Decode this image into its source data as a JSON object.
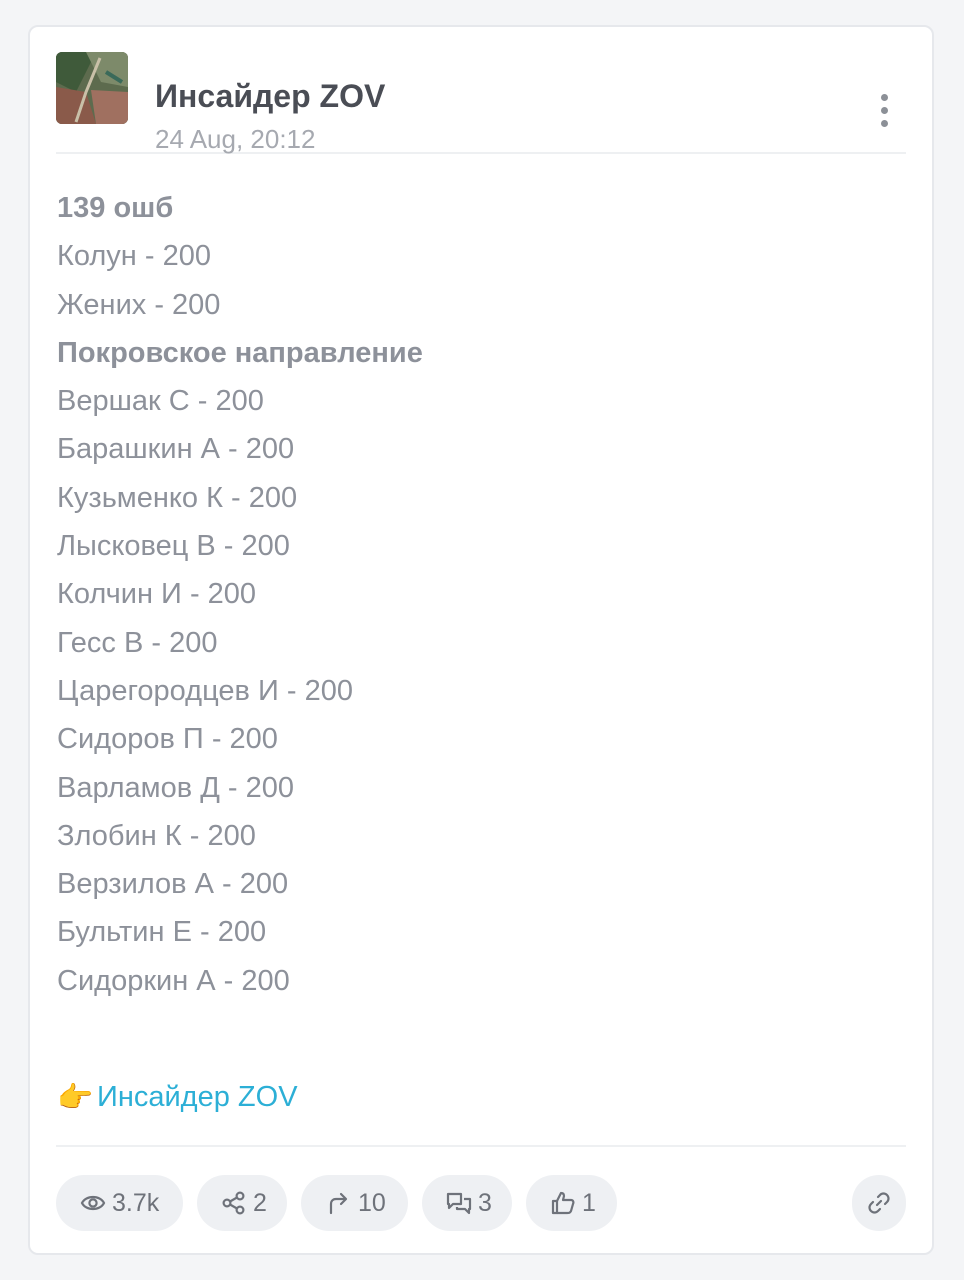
{
  "post": {
    "channel_name": "Инсайдер ZOV",
    "time": "24 Aug, 20:12",
    "lines": [
      {
        "text": "139 ошб",
        "bold": true
      },
      {
        "text": "Колун - 200",
        "bold": false
      },
      {
        "text": "Жених - 200",
        "bold": false
      },
      {
        "text": "Покровское направление",
        "bold": true
      },
      {
        "text": "Вершак С - 200",
        "bold": false
      },
      {
        "text": "Барашкин А - 200",
        "bold": false
      },
      {
        "text": "Кузьменко К - 200",
        "bold": false
      },
      {
        "text": "Лысковец В - 200",
        "bold": false
      },
      {
        "text": "Колчин И - 200",
        "bold": false
      },
      {
        "text": "Гесс В - 200",
        "bold": false
      },
      {
        "text": "Царегородцев И - 200",
        "bold": false
      },
      {
        "text": "Сидоров П - 200",
        "bold": false
      },
      {
        "text": "Варламов Д - 200",
        "bold": false
      },
      {
        "text": "Злобин К - 200",
        "bold": false
      },
      {
        "text": "Верзилов А - 200",
        "bold": false
      },
      {
        "text": "Бультин Е - 200",
        "bold": false
      },
      {
        "text": "Сидоркин А - 200",
        "bold": false
      }
    ],
    "signature_emoji": "👉",
    "signature_link": "Инсайдер ZOV"
  },
  "stats": {
    "views": "3.7k",
    "shares": "2",
    "forwards": "10",
    "comments": "3",
    "likes": "1"
  },
  "icons": {
    "views": "eye-icon",
    "shares": "share-icon",
    "forwards": "forward-arrow-icon",
    "comments": "comments-icon",
    "likes": "thumbs-up-icon",
    "link": "link-icon",
    "more": "more-vertical-icon"
  },
  "colors": {
    "text": "#8d919a",
    "link": "#2cafd6",
    "pill_bg": "#eef0f3"
  }
}
